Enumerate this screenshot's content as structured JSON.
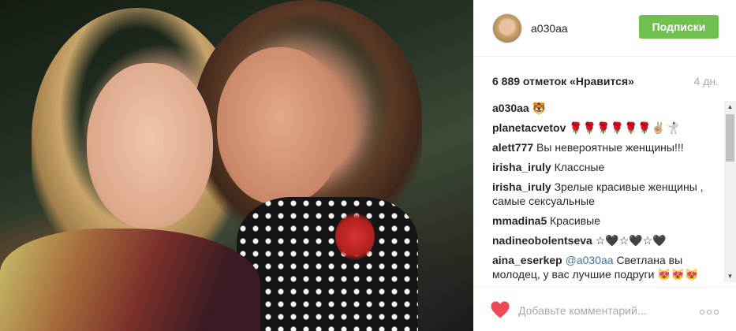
{
  "photo": {
    "subject": "photo-post"
  },
  "header": {
    "username": "a030aa",
    "follow_label": "Подписки"
  },
  "stats": {
    "likes": "6 889 отметок «Нравится»",
    "age": "4 дн."
  },
  "comments": [
    {
      "user": "a030aa",
      "text": " 🐯"
    },
    {
      "user": "planetacvetov",
      "text": " 🌹🌹🌹🌹🌹🌹✌🏼🤺"
    },
    {
      "user": "alett777",
      "text": " Вы невероятные женщины!!!"
    },
    {
      "user": "irisha_iruly",
      "text": " Классные"
    },
    {
      "user": "irisha_iruly",
      "text": " Зрелые красивые женщины , самые сексуальные"
    },
    {
      "user": "mmadina5",
      "text": " Красивые"
    },
    {
      "user": "nadineobolentseva",
      "text": " ☆🖤☆🖤☆🖤"
    },
    {
      "user": "aina_eserkep",
      "mention": "@a030aa",
      "text": " Светлана вы молодец, у вас лучшие подруги 😻😻😻"
    }
  ],
  "footer": {
    "comment_placeholder": "Добавьте комментарий..."
  },
  "icons": {
    "like": "heart-icon",
    "more": "more-options-icon"
  },
  "colors": {
    "follow": "#70c050",
    "heart": "#ed4956",
    "mention": "#3f729b"
  }
}
